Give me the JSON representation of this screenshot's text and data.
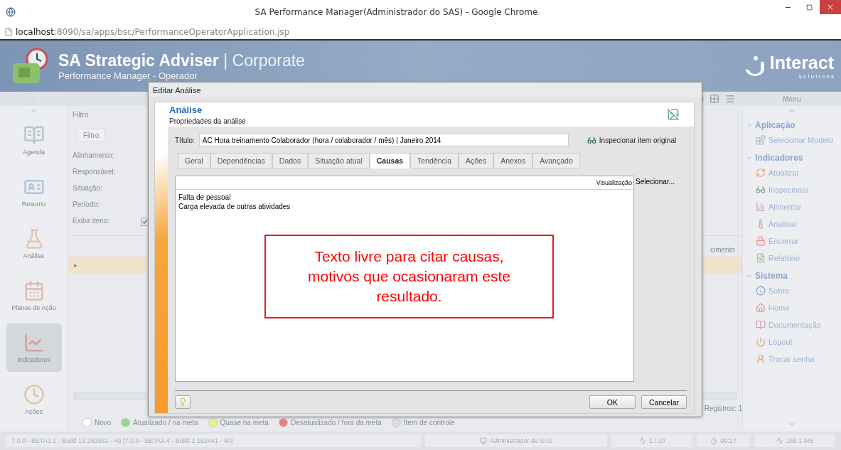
{
  "browser": {
    "title": "SA Performance Manager(Administrador do SAS) - Google Chrome",
    "url_host": "localhost",
    "url_path": ":8090/sa/apps/bsc/PerformanceOperatorApplication.jsp"
  },
  "header": {
    "product": "SA Strategic Adviser",
    "edition": "| Corporate",
    "subtitle": "Performance Manager - Operador",
    "brand": "Interact",
    "brand_sub": "s o l u t i o n s"
  },
  "nav": [
    {
      "label": "Agenda",
      "selected": false
    },
    {
      "label": "Resumo",
      "selected": false
    },
    {
      "label": "Análise",
      "selected": false
    },
    {
      "label": "Planos de Ação",
      "selected": false
    },
    {
      "label": "Indicadores",
      "selected": true
    },
    {
      "label": "Ações",
      "selected": false
    }
  ],
  "filter": {
    "title": "Filtro",
    "tab": "Filtro",
    "fields": [
      "Alinhamento:",
      "Responsável:",
      "Situação:",
      "Período:"
    ],
    "show_items": {
      "label": "Exibir itens:",
      "checked": true
    }
  },
  "grid": {
    "column_header": "cimento",
    "row_marker": "▸",
    "records": "Registros: 1"
  },
  "legend": [
    {
      "label": "Novo",
      "color": "#ffffff"
    },
    {
      "label": "Atualizado / na meta",
      "color": "#8fd88f"
    },
    {
      "label": "Quase na meta",
      "color": "#eeee80"
    },
    {
      "label": "Desatualizado / fora da meta",
      "color": "#e88080"
    },
    {
      "label": "Item de controle",
      "color": "#dddddd"
    }
  ],
  "menu": {
    "title": "Menu",
    "sections": [
      {
        "title": "Aplicação",
        "expanded": true,
        "items": [
          "Selecionar Modelo"
        ]
      },
      {
        "title": "Indicadores",
        "expanded": true,
        "items": [
          "Atualizar",
          "Inspecionar",
          "Alimentar",
          "Analisar",
          "Encerrar",
          "Relatório"
        ]
      },
      {
        "title": "Sistema",
        "expanded": true,
        "items": [
          "Sobre",
          "Home",
          "Documentação",
          "Logout",
          "Trocar senha"
        ]
      }
    ]
  },
  "status_bar": {
    "version": "7.0.0 - BETA3.1 - Build 13.152581 - 40 [7.0.0 - BETA3.4 - Build 2.152441 - 40]",
    "user": "Administrador do SAS",
    "page": "1 / 10",
    "time": "00:27",
    "memory": "159.1 MB"
  },
  "dialog": {
    "title": "Editar Análise",
    "heading": "Análise",
    "subheading": "Propriedades da análise",
    "title_label": "Título:",
    "title_value": "AC Hora treinamento Colaborador (hora / colaborador / mês) | Janeiro 2014",
    "inspect": "Inspecionar item original",
    "tabs": [
      {
        "label": "Geral",
        "selected": false
      },
      {
        "label": "Dependências",
        "selected": false
      },
      {
        "label": "Dados",
        "selected": false
      },
      {
        "label": "Situação atual",
        "selected": false
      },
      {
        "label": "Causas",
        "selected": true
      },
      {
        "label": "Tendência",
        "selected": false
      },
      {
        "label": "Ações",
        "selected": false
      },
      {
        "label": "Anexos",
        "selected": false
      },
      {
        "label": "Avançado",
        "selected": false
      }
    ],
    "preview": "Visualização",
    "select": "Selecionar...",
    "text_lines": [
      "Falta de pessoal",
      "Carga elevada de outras atividades"
    ],
    "ok": "OK",
    "cancel": "Cancelar"
  },
  "annotation": {
    "text": "Texto livre para citar causas, motivos que ocasionaram este resultado."
  }
}
